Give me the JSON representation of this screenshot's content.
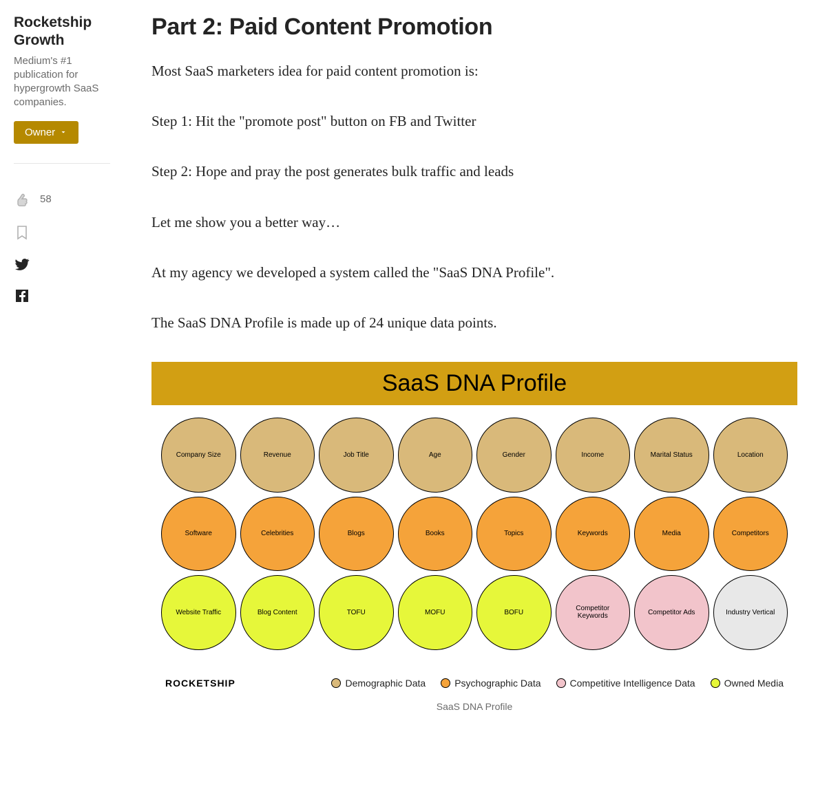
{
  "sidebar": {
    "publication_title": "Rocketship Growth",
    "publication_desc": "Medium's #1 publication for hypergrowth SaaS companies.",
    "owner_button_label": "Owner",
    "clap_count": "58"
  },
  "article": {
    "heading": "Part 2: Paid Content Promotion",
    "paragraphs": [
      "Most SaaS marketers idea for paid content promotion is:",
      "Step 1: Hit the \"promote post\" button on FB and Twitter",
      "Step 2: Hope and pray the post generates bulk traffic and leads",
      "Let me show you a better way…",
      "At my agency we developed a system called the \"SaaS DNA Profile\".",
      "The SaaS DNA Profile is made up of 24 unique data points."
    ]
  },
  "figure": {
    "title": "SaaS DNA Profile",
    "caption": "SaaS DNA Profile",
    "brand": "ROCKETSHIP",
    "circles": [
      {
        "label": "Company Size",
        "cat": "demo"
      },
      {
        "label": "Revenue",
        "cat": "demo"
      },
      {
        "label": "Job Title",
        "cat": "demo"
      },
      {
        "label": "Age",
        "cat": "demo"
      },
      {
        "label": "Gender",
        "cat": "demo"
      },
      {
        "label": "Income",
        "cat": "demo"
      },
      {
        "label": "Marital Status",
        "cat": "demo"
      },
      {
        "label": "Location",
        "cat": "demo"
      },
      {
        "label": "Software",
        "cat": "psycho"
      },
      {
        "label": "Celebrities",
        "cat": "psycho"
      },
      {
        "label": "Blogs",
        "cat": "psycho"
      },
      {
        "label": "Books",
        "cat": "psycho"
      },
      {
        "label": "Topics",
        "cat": "psycho"
      },
      {
        "label": "Keywords",
        "cat": "psycho"
      },
      {
        "label": "Media",
        "cat": "psycho"
      },
      {
        "label": "Competitors",
        "cat": "psycho"
      },
      {
        "label": "Website Traffic",
        "cat": "owned"
      },
      {
        "label": "Blog Content",
        "cat": "owned"
      },
      {
        "label": "TOFU",
        "cat": "owned"
      },
      {
        "label": "MOFU",
        "cat": "owned"
      },
      {
        "label": "BOFU",
        "cat": "owned"
      },
      {
        "label": "Competitor Keywords",
        "cat": "compint"
      },
      {
        "label": "Competitor Ads",
        "cat": "compint"
      },
      {
        "label": "Industry Vertical",
        "cat": "other"
      }
    ],
    "legend": [
      {
        "label": "Demographic Data",
        "cat": "demo"
      },
      {
        "label": "Psychographic Data",
        "cat": "psycho"
      },
      {
        "label": "Competitive Intelligence Data",
        "cat": "compint"
      },
      {
        "label": "Owned Media",
        "cat": "owned"
      }
    ]
  }
}
